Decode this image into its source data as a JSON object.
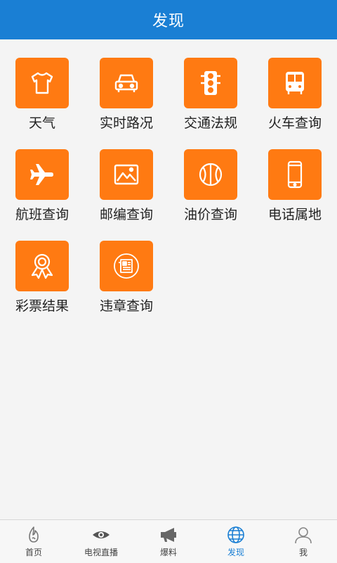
{
  "header": {
    "title": "发现"
  },
  "colors": {
    "brand": "#1a7fd4",
    "tile": "#ff7a12"
  },
  "tiles": [
    {
      "label": "天气",
      "icon": "tshirt-icon"
    },
    {
      "label": "实时路况",
      "icon": "car-icon"
    },
    {
      "label": "交通法规",
      "icon": "traffic-light-icon"
    },
    {
      "label": "火车查询",
      "icon": "bus-icon"
    },
    {
      "label": "航班查询",
      "icon": "airplane-icon"
    },
    {
      "label": "邮编查询",
      "icon": "picture-icon"
    },
    {
      "label": "油价查询",
      "icon": "basketball-icon"
    },
    {
      "label": "电话属地",
      "icon": "phone-icon"
    },
    {
      "label": "彩票结果",
      "icon": "award-ribbon-icon"
    },
    {
      "label": "违章查询",
      "icon": "newspaper-icon"
    }
  ],
  "tabs": [
    {
      "label": "首页",
      "icon": "flame-icon",
      "active": false
    },
    {
      "label": "电视直播",
      "icon": "eye-icon",
      "active": false
    },
    {
      "label": "爆料",
      "icon": "megaphone-icon",
      "active": false
    },
    {
      "label": "发现",
      "icon": "globe-icon",
      "active": true
    },
    {
      "label": "我",
      "icon": "user-icon",
      "active": false
    }
  ]
}
